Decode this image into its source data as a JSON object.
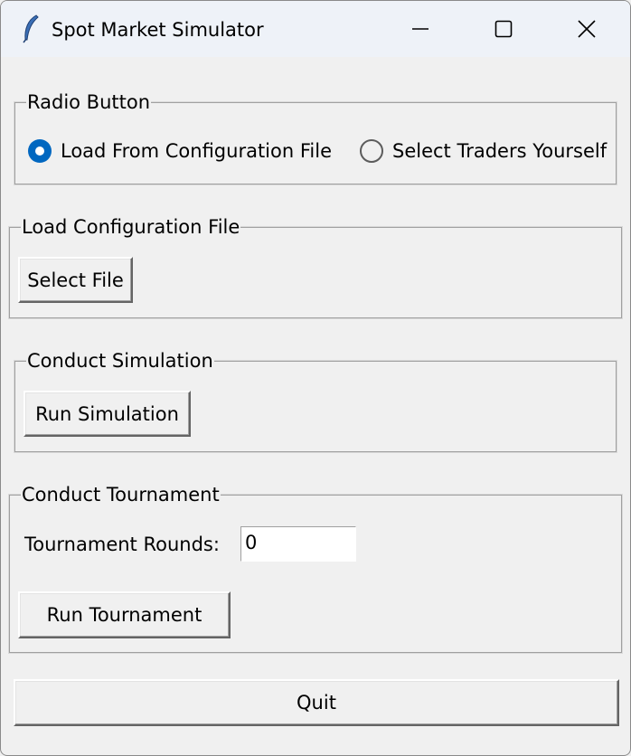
{
  "window": {
    "title": "Spot Market Simulator",
    "icon": "feather-icon",
    "controls": [
      "minimize-icon",
      "maximize-icon",
      "close-icon"
    ]
  },
  "mode_group": {
    "label": "Radio Button",
    "options": [
      {
        "label": "Load From Configuration File",
        "selected": true
      },
      {
        "label": "Select Traders Yourself",
        "selected": false
      }
    ]
  },
  "config_group": {
    "label": "Load Configuration File",
    "select_file_label": "Select File"
  },
  "simulation_group": {
    "label": "Conduct Simulation",
    "run_label": "Run Simulation"
  },
  "tournament_group": {
    "label": "Conduct Tournament",
    "rounds_label": "Tournament Rounds:",
    "rounds_value": "0",
    "run_label": "Run Tournament"
  },
  "quit_label": "Quit",
  "colors": {
    "radio_selected": "#0067c0",
    "background": "#f0f0f0",
    "titlebar": "#eef2f8"
  }
}
